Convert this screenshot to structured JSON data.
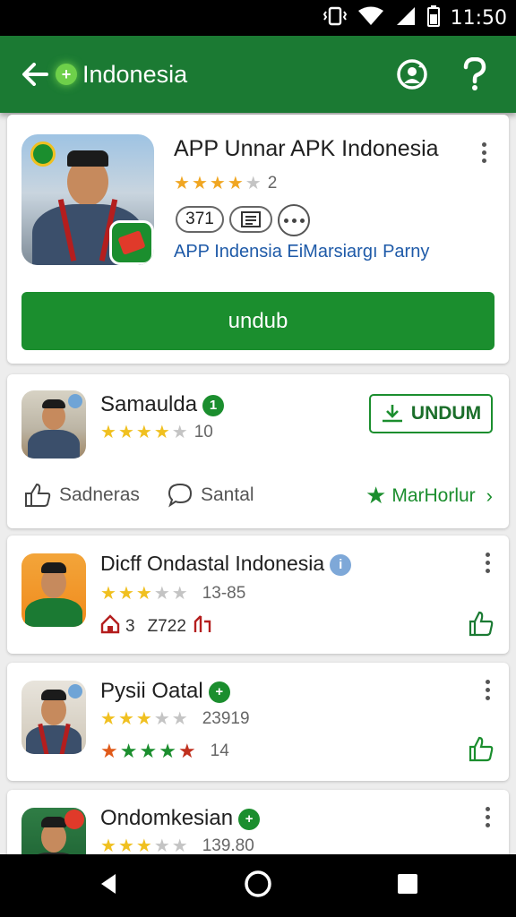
{
  "status_bar": {
    "time": "11:50"
  },
  "app_bar": {
    "title": "Indonesia",
    "logo_glyph": "+"
  },
  "featured": {
    "title": "APP Unnar APK Indonesia",
    "rating": 4,
    "rating_count": "2",
    "chip_count": "371",
    "link_text": "APP Indensia EiMarsiargı Parny",
    "primary_button": "undub"
  },
  "items": [
    {
      "name": "Samaulda",
      "badge": "1",
      "rating": 4,
      "rating_count": "10",
      "button": "UNDUM",
      "action_1": "Sadneras",
      "action_2": "Santal",
      "action_3": "MarHorlur"
    },
    {
      "name": "Dicff Ondastal Indonesia",
      "badge": "i",
      "rating": 3,
      "rating_count": "13-85",
      "meta_1": "3",
      "meta_2": "Z722"
    },
    {
      "name": "Pysii Oatal",
      "badge": "+",
      "rating": 3,
      "rating_count": "23919",
      "second_rating": 5,
      "second_count": "14"
    },
    {
      "name": "Ondomkesian",
      "badge": "+",
      "rating": 3,
      "rating_count": "139.80"
    }
  ],
  "colors": {
    "brand_green": "#1b7a33",
    "button_green": "#1b8e2e",
    "star_gold": "#f0a622",
    "star_gray": "#c4c4c4",
    "link_blue": "#1e5aa8"
  }
}
